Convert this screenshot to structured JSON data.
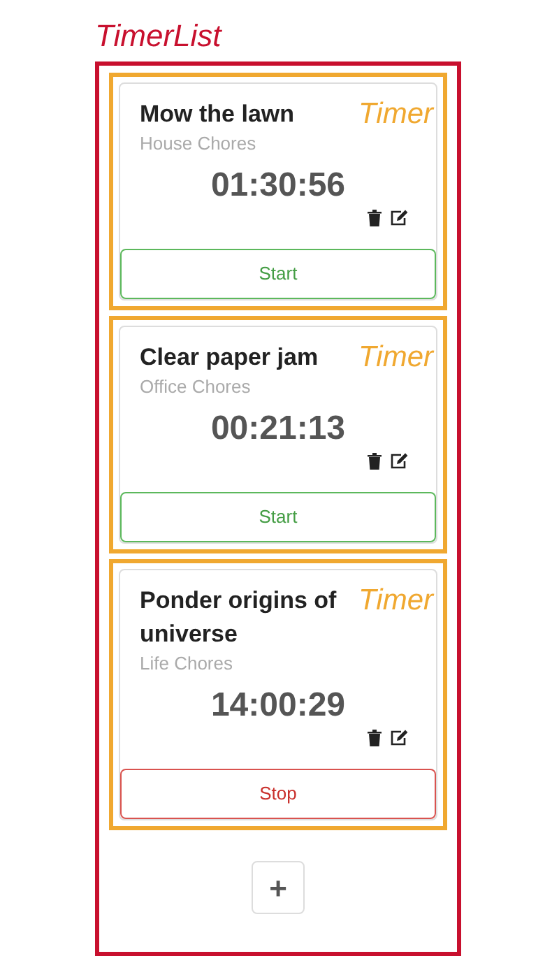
{
  "list_label": "TimerList",
  "timers": [
    {
      "annotation": "Timer",
      "title": "Mow the lawn",
      "project": "House Chores",
      "elapsed": "01:30:56",
      "running": false,
      "action": "Start"
    },
    {
      "annotation": "Timer",
      "title": "Clear paper jam",
      "project": "Office Chores",
      "elapsed": "00:21:13",
      "running": false,
      "action": "Start"
    },
    {
      "annotation": "Timer",
      "title": "Ponder origins of universe",
      "project": "Life Chores",
      "elapsed": "14:00:29",
      "running": true,
      "action": "Stop"
    }
  ],
  "add_button": "+"
}
